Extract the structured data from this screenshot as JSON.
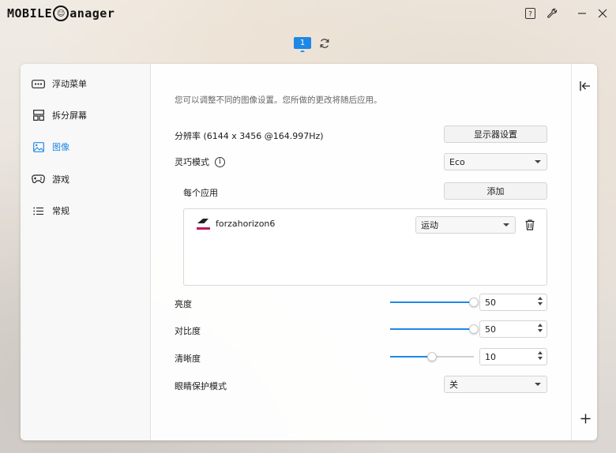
{
  "app": {
    "logo_text_left": "MOBILE",
    "logo_text_right": "anager",
    "window_buttons": [
      "help-icon",
      "wrench-icon",
      "minimize-icon",
      "close-icon"
    ]
  },
  "monitor": {
    "number": "1"
  },
  "sidebar": {
    "items": [
      {
        "label": "浮动菜单",
        "icon": "floating-menu-icon"
      },
      {
        "label": "拆分屏幕",
        "icon": "split-screen-icon"
      },
      {
        "label": "图像",
        "icon": "image-icon",
        "active": true
      },
      {
        "label": "游戏",
        "icon": "gamepad-icon"
      },
      {
        "label": "常规",
        "icon": "list-icon"
      }
    ]
  },
  "content": {
    "intro": "您可以调整不同的图像设置。您所做的更改将随后应用。",
    "resolution_label": "分辨率 (6144 x 3456 @164.997Hz)",
    "display_settings_button": "显示器设置",
    "smart_mode_label": "灵巧模式",
    "smart_mode_value": "Eco",
    "per_app_label": "每个应用",
    "add_button": "添加",
    "apps": [
      {
        "name": "forzahorizon6",
        "mode": "运动"
      }
    ],
    "brightness": {
      "label": "亮度",
      "value": "50",
      "level": 1.0
    },
    "contrast": {
      "label": "对比度",
      "value": "50",
      "level": 1.0
    },
    "sharpness": {
      "label": "清晰度",
      "value": "10",
      "level": 0.5
    },
    "eye_care": {
      "label": "眼睛保护模式",
      "value": "关"
    }
  },
  "colors": {
    "accent": "#1e88e5"
  }
}
